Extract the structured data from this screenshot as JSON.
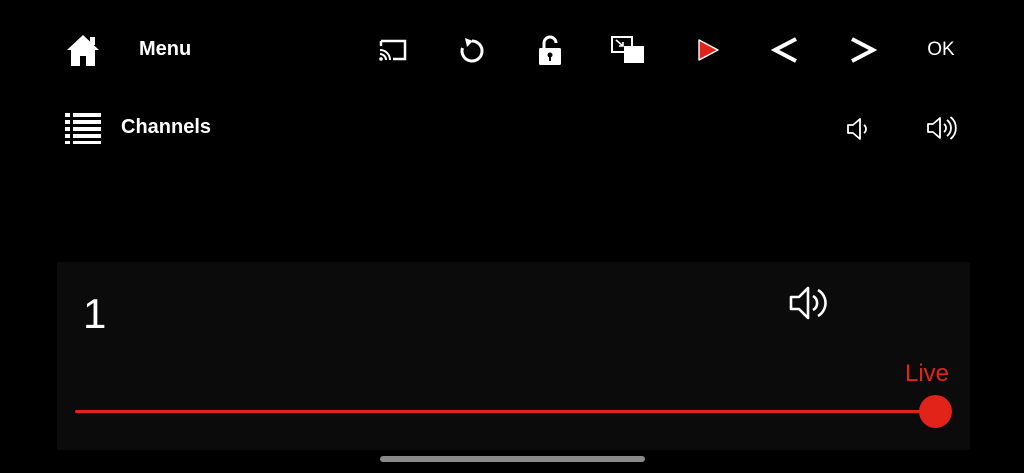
{
  "header": {
    "menu_label": "Menu",
    "channels_label": "Channels",
    "ok_label": "OK",
    "icons": {
      "home": "home-icon",
      "channels": "list-icon",
      "cast": "cast-icon",
      "refresh": "refresh-icon",
      "lock": "unlock-icon",
      "pip": "picture-in-picture-icon",
      "play": "play-icon",
      "prev": "chevron-left-icon",
      "next": "chevron-right-icon",
      "volume_down": "volume-down-icon",
      "volume_up": "volume-up-icon"
    }
  },
  "player": {
    "channel_number": "1",
    "live_label": "Live",
    "progress": 1.0,
    "mute_icon": "speaker-icon"
  },
  "colors": {
    "accent": "#e2231a",
    "background": "#000000",
    "panel": "#0b0b0b"
  }
}
